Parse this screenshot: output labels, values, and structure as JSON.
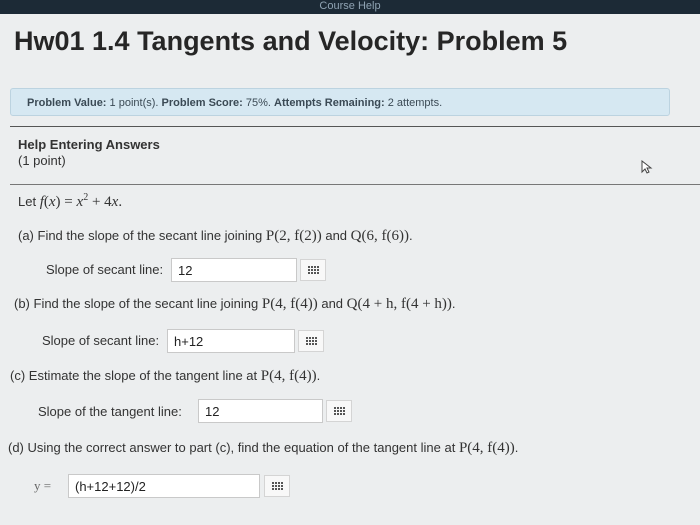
{
  "topbar": {
    "text": "Course Help"
  },
  "page": {
    "title": "Hw01 1.4 Tangents and Velocity: Problem 5"
  },
  "score_bar": {
    "problem_value_label": "Problem Value:",
    "problem_value": "1 point(s).",
    "problem_score_label": "Problem Score:",
    "problem_score": "75%.",
    "attempts_label": "Attempts Remaining:",
    "attempts": "2 attempts."
  },
  "help": {
    "link": "Help Entering Answers",
    "points": "(1 point)"
  },
  "problem": {
    "intro_prefix": "Let",
    "part_a": {
      "text": "(a) Find the slope of the secant line joining",
      "p": "P(2, f(2))",
      "and": "and",
      "q": "Q(6, f(6))",
      "end": ".",
      "label": "Slope of secant line:",
      "value": "12"
    },
    "part_b": {
      "text": "(b) Find the slope of the secant line joining",
      "p": "P(4, f(4))",
      "and": "and",
      "q": "Q(4 + h, f(4 + h))",
      "end": ".",
      "label": "Slope of secant line:",
      "value": "h+12"
    },
    "part_c": {
      "text": "(c) Estimate the slope of the tangent line at",
      "p": "P(4, f(4))",
      "end": ".",
      "label": "Slope of the tangent line:",
      "value": "12"
    },
    "part_d": {
      "text": "(d) Using the correct answer to part (c), find the equation of the tangent line at",
      "p": "P(4, f(4))",
      "end": ".",
      "label": "y =",
      "value": "(h+12+12)/2"
    }
  }
}
